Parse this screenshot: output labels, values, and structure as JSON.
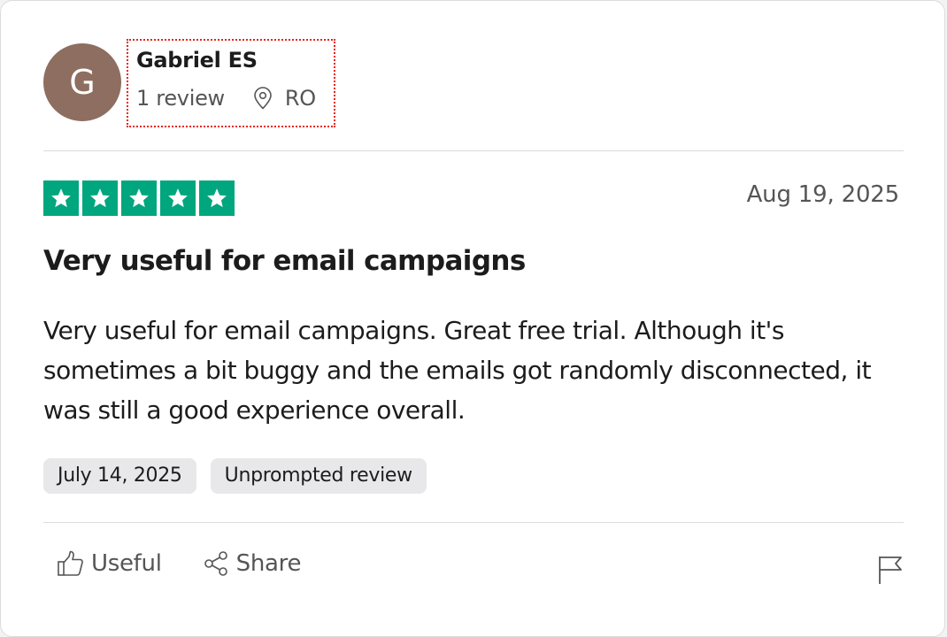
{
  "consumer": {
    "avatar_initial": "G",
    "avatar_color": "#8e6e60",
    "name": "Gabriel ES",
    "review_count": "1 review",
    "location_icon": "location-pin-icon",
    "country": "RO"
  },
  "review": {
    "rating": 5,
    "star_color": "#00a67e",
    "date": "Aug 19, 2025",
    "title": "Very useful for email campaigns",
    "body": "Very useful for email campaigns. Great free trial. Although it's sometimes a bit buggy and the emails got randomly disconnected, it was still a good experience overall.",
    "tags": [
      {
        "label": "July 14, 2025"
      },
      {
        "label": "Unprompted review"
      }
    ]
  },
  "actions": {
    "useful_label": "Useful",
    "useful_icon": "thumbs-up-icon",
    "share_label": "Share",
    "share_icon": "share-icon",
    "report_icon": "flag-icon"
  },
  "highlight_color": "#e8231a"
}
